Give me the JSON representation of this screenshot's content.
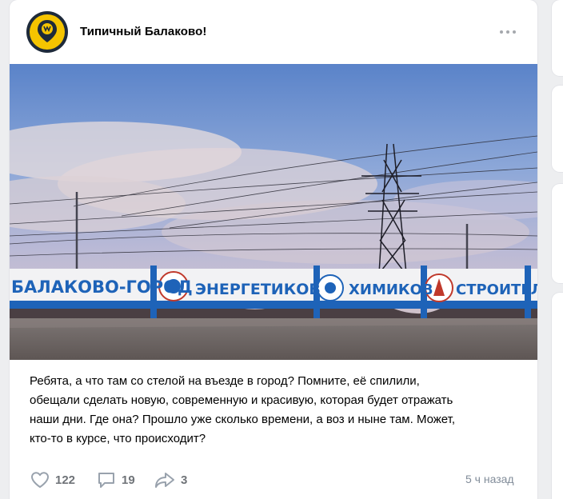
{
  "post": {
    "group_name": "Типичный Балаково!",
    "avatar_icon": "group-logo-icon",
    "more_icon": "more-dots-icon",
    "photo": {
      "sign_text_1": "БАЛАКОВО-ГОРОД",
      "sign_text_2": "ЭНЕРГЕТИКОВ",
      "sign_text_3": "ХИМИКОВ",
      "sign_text_4": "СТРОИТЕЛЕЙ"
    },
    "text_lines": [
      "Ребята, а что там со стелой на въезде в город? Помните, её спилили,",
      "обещали сделать новую, современную и красивую, которая будет отражать",
      "наши дни. Где она? Прошло уже сколько времени, а воз и ныне там. Может,",
      "кто-то в курсе, что происходит?"
    ],
    "likes": "122",
    "comments": "19",
    "shares": "3",
    "time": "5 ч назад"
  },
  "colors": {
    "background": "#edeef0",
    "card": "#ffffff",
    "icon_gray": "#99a2ad",
    "avatar_yellow": "#f5c400",
    "sign_blue": "#1e63b8"
  }
}
